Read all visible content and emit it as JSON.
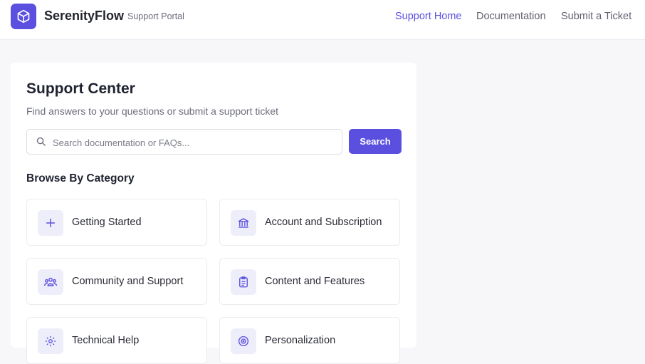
{
  "header": {
    "brand": "SerenityFlow",
    "subtitle": "Support Portal",
    "nav": [
      {
        "label": "Support Home",
        "active": true
      },
      {
        "label": "Documentation",
        "active": false
      },
      {
        "label": "Submit a Ticket",
        "active": false
      }
    ]
  },
  "main": {
    "title": "Support Center",
    "subtitle": "Find answers to your questions or submit a support ticket",
    "search": {
      "placeholder": "Search documentation or FAQs...",
      "value": "",
      "button_label": "Search"
    },
    "category_heading": "Browse By Category",
    "categories": [
      {
        "label": "Getting Started",
        "icon": "plus-icon"
      },
      {
        "label": "Account and Subscription",
        "icon": "bank-icon"
      },
      {
        "label": "Community and Support",
        "icon": "users-icon"
      },
      {
        "label": "Content and Features",
        "icon": "clipboard-icon"
      },
      {
        "label": "Technical Help",
        "icon": "gear-icon"
      },
      {
        "label": "Personalization",
        "icon": "target-icon"
      }
    ]
  },
  "colors": {
    "accent": "#5b4fe0",
    "icon_bg": "#eeeefa",
    "page_bg": "#f7f7fa"
  }
}
